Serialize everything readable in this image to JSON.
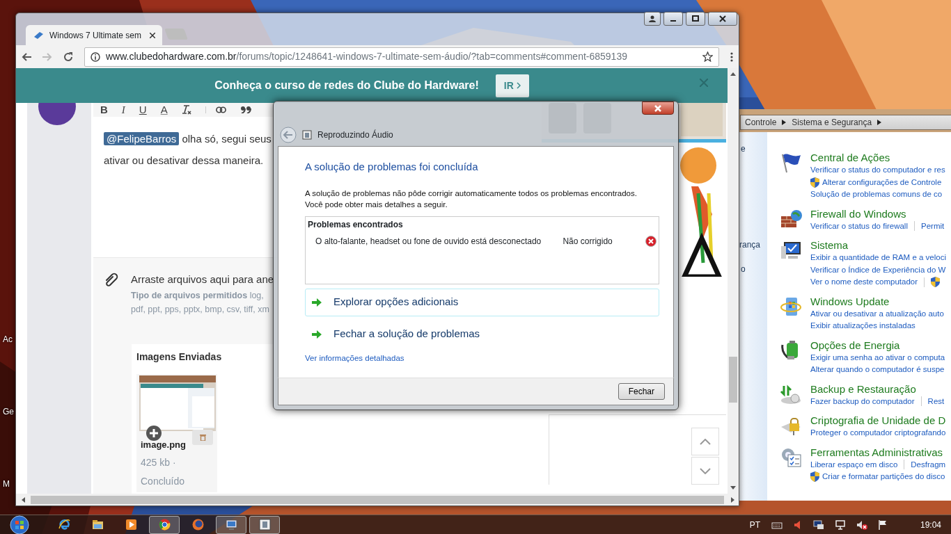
{
  "desktop": {
    "icon_labels": [
      "Ac",
      "Ge",
      "M"
    ]
  },
  "control_panel": {
    "breadcrumb": [
      "Controle",
      "Sistema e Segurança"
    ],
    "nav_fragments": [
      "e",
      "rança",
      "o"
    ],
    "categories": [
      {
        "title": "Central de Ações",
        "lines": [
          [
            {
              "text": "Verificar o status do computador e res",
              "shield": false
            }
          ],
          [
            {
              "text": "Alterar configurações de Controle",
              "shield": true
            }
          ],
          [
            {
              "text": "Solução de problemas comuns de co",
              "shield": false
            }
          ]
        ]
      },
      {
        "title": "Firewall do Windows",
        "lines": [
          [
            {
              "text": "Verificar o status do firewall",
              "shield": false
            },
            {
              "text": "Permit",
              "shield": false
            }
          ]
        ]
      },
      {
        "title": "Sistema",
        "lines": [
          [
            {
              "text": "Exibir a quantidade de RAM e a veloci",
              "shield": false
            }
          ],
          [
            {
              "text": "Verificar o Índice de Experiência do W",
              "shield": false
            }
          ],
          [
            {
              "text": "Ver o nome deste computador",
              "shield": false
            },
            {
              "shield": true
            }
          ]
        ]
      },
      {
        "title": "Windows Update",
        "lines": [
          [
            {
              "text": "Ativar ou desativar a atualização auto",
              "shield": false
            }
          ],
          [
            {
              "text": "Exibir atualizações instaladas",
              "shield": false
            }
          ]
        ]
      },
      {
        "title": "Opções de Energia",
        "lines": [
          [
            {
              "text": "Exigir uma senha ao ativar o computa",
              "shield": false
            }
          ],
          [
            {
              "text": "Alterar quando o computador é suspe",
              "shield": false
            }
          ]
        ]
      },
      {
        "title": "Backup e Restauração",
        "lines": [
          [
            {
              "text": "Fazer backup do computador",
              "shield": false
            },
            {
              "text": "Rest",
              "shield": false
            }
          ]
        ]
      },
      {
        "title": "Criptografia de Unidade de D",
        "lines": [
          [
            {
              "text": "Proteger o computador criptografando",
              "shield": false
            }
          ]
        ]
      },
      {
        "title": "Ferramentas Administrativas",
        "lines": [
          [
            {
              "text": "Liberar espaço em disco",
              "shield": false
            },
            {
              "text": "Desfragm",
              "shield": false
            }
          ],
          [
            {
              "text": "Criar e formatar partições do disco",
              "shield": true
            }
          ]
        ]
      }
    ]
  },
  "browser": {
    "tabs": [
      {
        "title": "Windows 7 Ultimate sem",
        "selected": true
      }
    ],
    "url": {
      "host": "www.clubedohardware.com.br",
      "path": "/forums/topic/1248641-windows-7-ultimate-sem-áudio/?tab=comments#comment-6859139"
    },
    "banner": {
      "text": "Conheça o curso de redes do Clube do Hardware!",
      "button": "IR"
    },
    "editor": {
      "toolbar": [
        {
          "label": "B",
          "kind": "bold"
        },
        {
          "label": "I",
          "kind": "italic"
        },
        {
          "label": "U",
          "kind": "underline"
        },
        {
          "label": "A",
          "kind": "color"
        }
      ],
      "mention": "@FelipeBarros",
      "line1": "olha só, segui seus",
      "line2": "ativar ou desativar dessa maneira."
    },
    "attachments": {
      "drop_text": "Arraste arquivos aqui para ane",
      "allowed_label": "Tipo de arquivos permitidos",
      "allowed_line1": "log,",
      "allowed_line2": "pdf, ppt, pps, pptx, bmp, csv, tiff, xm"
    },
    "uploads": {
      "title": "Imagens Enviadas",
      "files": [
        {
          "name": "image.png",
          "size": "425 kb ·",
          "status": "Concluído"
        }
      ]
    }
  },
  "dialog": {
    "title": "Reproduzindo Áudio",
    "heading": "A solução de problemas foi concluída",
    "message": [
      "A solução de problemas não pôde corrigir automaticamente todos os problemas encontrados.",
      "Você pode obter mais detalhes a seguir."
    ],
    "problems": {
      "title": "Problemas encontrados",
      "items": [
        {
          "description": "O alto-falante, headset ou fone de ouvido está desconectado",
          "status": "Não corrigido",
          "fixed": false
        }
      ]
    },
    "commands": [
      {
        "label": "Explorar opções adicionais",
        "hovered": true
      },
      {
        "label": "Fechar a solução de problemas",
        "hovered": false
      }
    ],
    "details_link": "Ver informações detalhadas",
    "button": "Fechar"
  },
  "taskbar": {
    "apps": [
      {
        "active": false
      },
      {
        "active": false
      },
      {
        "active": false
      },
      {
        "active": true
      },
      {
        "active": false
      },
      {
        "active": true
      },
      {
        "active": true
      }
    ],
    "language": "PT",
    "clock": "19:04"
  }
}
